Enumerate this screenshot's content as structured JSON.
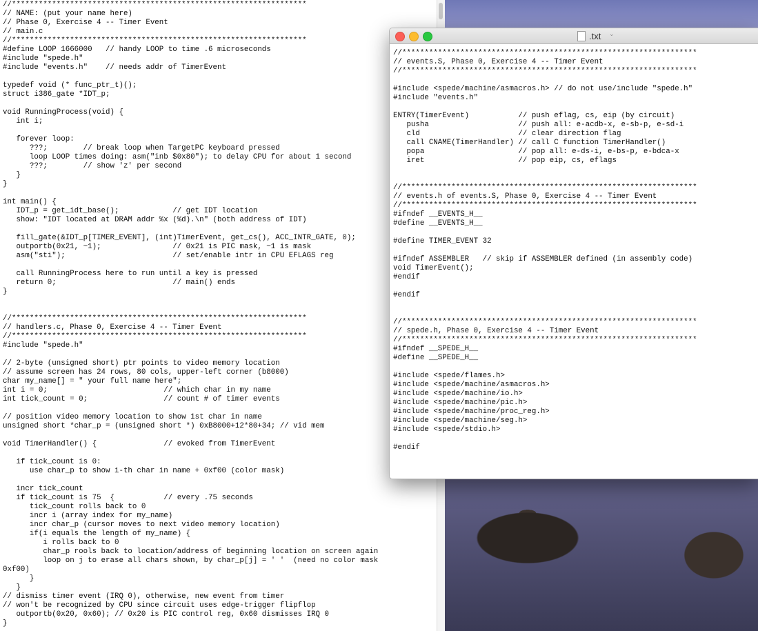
{
  "left_file": {
    "lines": [
      "//******************************************************************",
      "// NAME: (put your name here)",
      "// Phase 0, Exercise 4 -- Timer Event",
      "// main.c",
      "//******************************************************************",
      "#define LOOP 1666000   // handy LOOP to time .6 microseconds",
      "#include \"spede.h\"",
      "#include \"events.h\"    // needs addr of TimerEvent",
      "",
      "typedef void (* func_ptr_t)();",
      "struct i386_gate *IDT_p;",
      "",
      "void RunningProcess(void) {",
      "   int i;",
      "",
      "   forever loop:",
      "      ???;        // break loop when TargetPC keyboard pressed",
      "      loop LOOP times doing: asm(\"inb $0x80\"); to delay CPU for about 1 second",
      "      ???;        // show 'z' per second",
      "   }",
      "}",
      "",
      "int main() {",
      "   IDT_p = get_idt_base();            // get IDT location",
      "   show: \"IDT located at DRAM addr %x (%d).\\n\" (both address of IDT)",
      "",
      "   fill_gate(&IDT_p[TIMER_EVENT], (int)TimerEvent, get_cs(), ACC_INTR_GATE, 0);",
      "   outportb(0x21, ~1);                // 0x21 is PIC mask, ~1 is mask",
      "   asm(\"sti\");                        // set/enable intr in CPU EFLAGS reg",
      "",
      "   call RunningProcess here to run until a key is pressed",
      "   return 0;                          // main() ends",
      "}",
      "",
      "",
      "//******************************************************************",
      "// handlers.c, Phase 0, Exercise 4 -- Timer Event",
      "//******************************************************************",
      "#include \"spede.h\"",
      "",
      "// 2-byte (unsigned short) ptr points to video memory location",
      "// assume screen has 24 rows, 80 cols, upper-left corner (b8000)",
      "char my_name[] = \" your full name here\";",
      "int i = 0;                          // which char in my name",
      "int tick_count = 0;                 // count # of timer events",
      "",
      "// position video memory location to show 1st char in name",
      "unsigned short *char_p = (unsigned short *) 0xB8000+12*80+34; // vid mem",
      "",
      "void TimerHandler() {               // evoked from TimerEvent",
      "",
      "   if tick_count is 0:",
      "      use char_p to show i-th char in name + 0xf00 (color mask)",
      "",
      "   incr tick_count",
      "   if tick_count is 75  {           // every .75 seconds",
      "      tick_count rolls back to 0",
      "      incr i (array index for my_name)",
      "      incr char_p (cursor moves to next video memory location)",
      "      if(i equals the length of my_name) {",
      "         i rolls back to 0",
      "         char_p rools back to location/address of beginning location on screen again",
      "         loop on j to erase all chars shown, by char_p[j] = ' '  (need no color mask",
      "0xf00)",
      "      }",
      "   }",
      "// dismiss timer event (IRQ 0), otherwise, new event from timer",
      "// won't be recognized by CPU since circuit uses edge-trigger flipflop",
      "   outportb(0x20, 0x60); // 0x20 is PIC control reg, 0x60 dismisses IRQ 0",
      "}"
    ]
  },
  "window": {
    "title": ".txt",
    "title_chevron": "⌄",
    "lines": [
      "//******************************************************************",
      "// events.S, Phase 0, Exercise 4 -- Timer Event",
      "//******************************************************************",
      "",
      "#include <spede/machine/asmacros.h> // do not use/include \"spede.h\"",
      "#include \"events.h\"",
      "",
      "ENTRY(TimerEvent)           // push eflag, cs, eip (by circuit)",
      "   pusha                    // push all: e-acdb-x, e-sb-p, e-sd-i",
      "   cld                      // clear direction flag",
      "   call CNAME(TimerHandler) // call C function TimerHandler()",
      "   popa                     // pop all: e-ds-i, e-bs-p, e-bdca-x",
      "   iret                     // pop eip, cs, eflags",
      "",
      "",
      "//******************************************************************",
      "// events.h of events.S, Phase 0, Exercise 4 -- Timer Event",
      "//******************************************************************",
      "#ifndef __EVENTS_H__",
      "#define __EVENTS_H__",
      "",
      "#define TIMER_EVENT 32",
      "",
      "#ifndef ASSEMBLER   // skip if ASSEMBLER defined (in assembly code)",
      "void TimerEvent();",
      "#endif",
      "",
      "#endif",
      "",
      "",
      "//******************************************************************",
      "// spede.h, Phase 0, Exercise 4 -- Timer Event",
      "//******************************************************************",
      "#ifndef __SPEDE_H__",
      "#define __SPEDE_H__",
      "",
      "#include <spede/flames.h>",
      "#include <spede/machine/asmacros.h>",
      "#include <spede/machine/io.h>",
      "#include <spede/machine/pic.h>",
      "#include <spede/machine/proc_reg.h>",
      "#include <spede/machine/seg.h>",
      "#include <spede/stdio.h>",
      "",
      "#endif"
    ]
  },
  "spellcheck_words": [
    "spede",
    "addr",
    "func_ptr_t",
    "idt",
    "get_cs",
    "outportb",
    "sti",
    "intr",
    "incr",
    "i-th",
    "rools",
    "asmacros",
    "pusha",
    "popa",
    "iret",
    "eflag",
    "eip",
    "eflags",
    "e-acdb-x",
    "e-sb-p",
    "e-sd-i",
    "e-ds-i",
    "e-bs-p",
    "e-bdca-x",
    "inb",
    "mem",
    "get_idt_base"
  ]
}
